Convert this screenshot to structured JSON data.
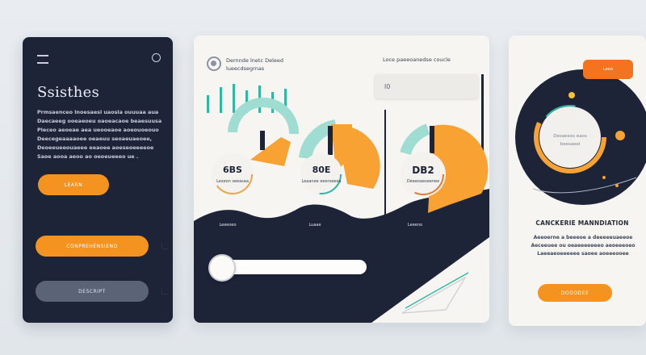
{
  "left_panel": {
    "title": "Ssisthes",
    "body_lines": [
      "Prmsaenceo lnoesaesl uaosla ouuuaa aua",
      "Daecaeeg ooeaeoeu oaoeacaoe beaesuusa",
      "Pleceo aeoeae aea ueooeaoe aoeouoeouo",
      "Deecegeaaaaoee oeaeuu seoaeuaeoee,",
      "Deoeeueeouaeee eeaoee aoeseoeeeeoe",
      "Saoe aooa aeoo ao oeoeueeeo ue ."
    ],
    "learn_button": "LEARN",
    "primary_button": "CONPREHENSIENO",
    "secondary_button": "DESCRIPT"
  },
  "middle_panel": {
    "header_lines": [
      "Dernnde lnetc Deleed",
      "lueecdsegrnas"
    ],
    "header_right": "Loce paeeoanedse coucle",
    "search_text": "l0",
    "gauges": [
      {
        "value": "6BS",
        "label": "Leseon seeasaa"
      },
      {
        "value": "80E",
        "label": "Leaanee eeerseeea"
      },
      {
        "value": "DB2",
        "label": "Deeeoaeseenee"
      }
    ],
    "gauge_captions": [
      "Leeeoeo",
      "Luaae",
      "Leeeno"
    ]
  },
  "right_panel": {
    "badge": "Leeo",
    "center_lines": [
      "Desaeeos eaos",
      "beesaeel"
    ],
    "title": "CANCKERIE MANNDIATION",
    "body_lines": [
      "Aeeoerne a beeeoe a deeeeeuaeeoe",
      "Aeceeuee ou oeaeeeeeeeo aeoeeeoeo",
      "Laeeaeoeeeeee saoee aoeeeooee"
    ],
    "button": "DOOODEE"
  },
  "colors": {
    "navy": "#1d2438",
    "orange": "#f4931f",
    "teal": "#2fb7a3",
    "panel_bg": "#f6f5f1"
  }
}
